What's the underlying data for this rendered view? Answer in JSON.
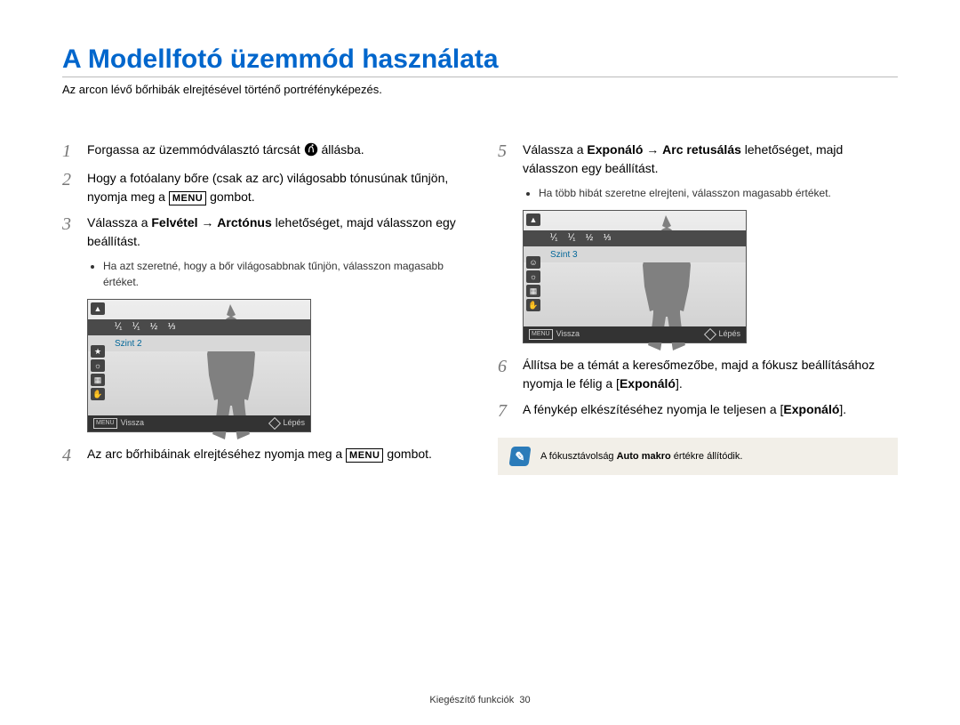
{
  "title": "A Modellfotó üzemmód használata",
  "subtitle": "Az arcon lévő bőrhibák elrejtésével történő portréfényképezés.",
  "labels": {
    "menu": "MENU",
    "back": "Vissza",
    "move": "Lépés"
  },
  "left": {
    "s1": {
      "n": "1",
      "a": "Forgassa az üzemmódválasztó tárcsát ",
      "b": " állásba."
    },
    "s2": {
      "n": "2",
      "a": "Hogy a fotóalany bőre (csak az arc) világosabb tónusúnak tűnjön, nyomja meg a ",
      "b": " gombot."
    },
    "s3": {
      "n": "3",
      "a": "Válassza a ",
      "bold1": "Felvétel",
      "arrow": " → ",
      "bold2": "Arctónus",
      "b": " lehetőséget, majd válasszon egy beállítást."
    },
    "hint3": "Ha azt szeretné, hogy a bőr világosabbnak tűnjön, válasszon magasabb értéket.",
    "lvl": "Szint 2",
    "s4": {
      "n": "4",
      "a": "Az arc bőrhibáinak elrejtéséhez nyomja meg a ",
      "b": " gombot."
    }
  },
  "right": {
    "s5": {
      "n": "5",
      "a": "Válassza a ",
      "bold1": "Exponáló",
      "arrow": " → ",
      "bold2": "Arc retusálás",
      "b": " lehetőséget, majd válasszon egy beállítást."
    },
    "hint5": "Ha több hibát szeretne elrejteni, válasszon magasabb értéket.",
    "lvl": "Szint 3",
    "s6": {
      "n": "6",
      "a": "Állítsa be a témát a keresőmezőbe, majd a fókusz beállításához nyomja le félig a [",
      "bold": "Exponáló",
      "b": "]."
    },
    "s7": {
      "n": "7",
      "a": "A fénykép elkészítéséhez nyomja le teljesen a [",
      "bold": "Exponáló",
      "b": "]."
    },
    "note": {
      "a": "A fókusztávolság ",
      "bold": "Auto makro",
      "b": " értékre állítódik."
    }
  },
  "footer": {
    "section": "Kiegészítő funkciók",
    "page": "30"
  }
}
